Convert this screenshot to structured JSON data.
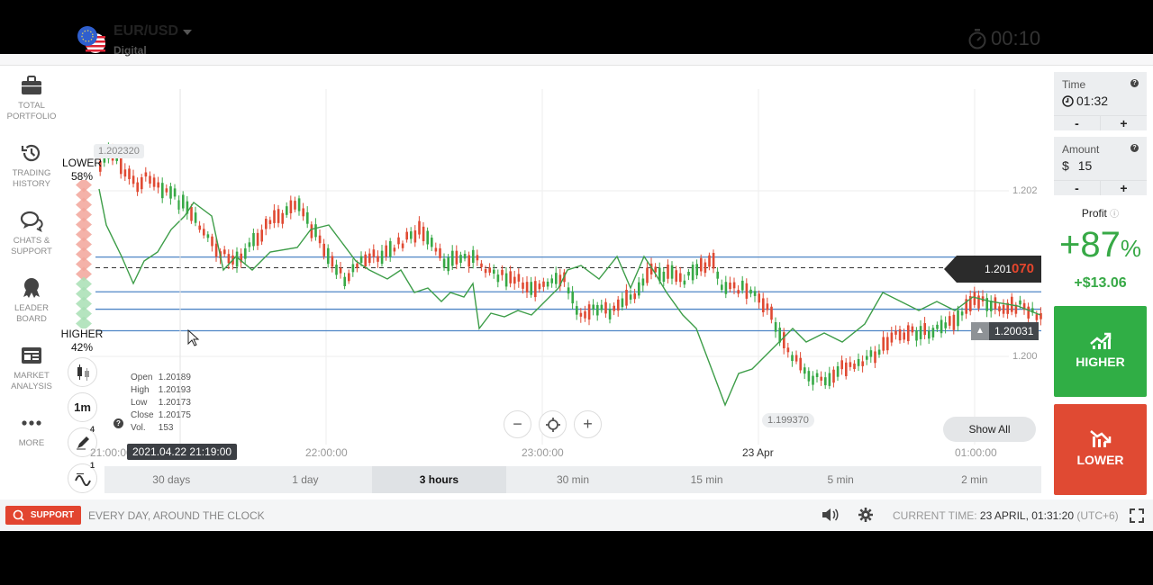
{
  "sidebar": {
    "items": [
      {
        "label_1": "TOTAL",
        "label_2": "PORTFOLIO",
        "icon": "briefcase-icon"
      },
      {
        "label_1": "TRADING",
        "label_2": "HISTORY",
        "icon": "history-icon"
      },
      {
        "label_1": "CHATS &",
        "label_2": "SUPPORT",
        "icon": "chat-icon"
      },
      {
        "label_1": "LEADER",
        "label_2": "BOARD",
        "icon": "award-icon"
      },
      {
        "label_1": "MARKET",
        "label_2": "ANALYSIS",
        "icon": "newspaper-icon"
      },
      {
        "label_1": "MORE",
        "label_2": "",
        "icon": "more-icon"
      }
    ]
  },
  "asset": {
    "name": "EUR/USD",
    "type": "Digital"
  },
  "timer": {
    "value": "00:10"
  },
  "sentiment": {
    "lower_label": "LOWER",
    "lower_pct": "58%",
    "higher_label": "HIGHER",
    "higher_pct": "42%",
    "lower_fraction": 0.58
  },
  "tools": {
    "chart_type_icon": "candles-icon",
    "interval": "1m",
    "drawings_count": "4",
    "indicators_count": "1"
  },
  "ohlc": {
    "open_label": "Open",
    "open": "1.20189",
    "high_label": "High",
    "high": "1.20193",
    "low_label": "Low",
    "low": "1.20173",
    "close_label": "Close",
    "close": "1.20175",
    "vol_label": "Vol.",
    "vol": "153"
  },
  "chart": {
    "high_marker": "1.202320",
    "low_marker": "1.199370",
    "current_price_main": "1.201",
    "current_price_hi": "070",
    "alert_price": "1.20031",
    "y_ticks": [
      {
        "label": "1.202",
        "value": 1.202
      },
      {
        "label": "1.200",
        "value": 1.2
      }
    ],
    "crosshair_time": "2021.04.22 21:19:00",
    "x_ticks": [
      {
        "label": "21:00:00",
        "strong": false
      },
      {
        "label": "22:00:00",
        "strong": false
      },
      {
        "label": "23:00:00",
        "strong": false
      },
      {
        "label": "23 Apr",
        "strong": true
      },
      {
        "label": "01:00:00",
        "strong": false
      }
    ],
    "show_all_label": "Show All",
    "horizontal_levels": [
      1.2012,
      1.20078,
      1.20057,
      1.20031
    ],
    "dashed_level": 1.20107
  },
  "timeframes": [
    {
      "label": "30 days",
      "active": false
    },
    {
      "label": "1 day",
      "active": false
    },
    {
      "label": "3 hours",
      "active": true
    },
    {
      "label": "30 min",
      "active": false
    },
    {
      "label": "15 min",
      "active": false
    },
    {
      "label": "5 min",
      "active": false
    },
    {
      "label": "2 min",
      "active": false
    }
  ],
  "right_panel": {
    "time_label": "Time",
    "time_value": "01:32",
    "amount_label": "Amount",
    "amount_currency": "$",
    "amount_value": "15",
    "minus": "-",
    "plus": "+",
    "profit_label": "Profit",
    "profit_pct": "+87",
    "profit_pct_sign": "%",
    "profit_amount": "+$13.06",
    "higher_label": "HIGHER",
    "lower_label": "LOWER"
  },
  "colors": {
    "up": "#37a946",
    "down": "#e04a33",
    "level": "#4f86c6",
    "indicator": "#3d9d48"
  },
  "footer": {
    "support_label": "SUPPORT",
    "support_text": "EVERY DAY, AROUND THE CLOCK",
    "current_time_label": "CURRENT TIME:",
    "current_time_value": "23 APRIL, 01:31:20",
    "timezone": "(UTC+6)"
  }
}
